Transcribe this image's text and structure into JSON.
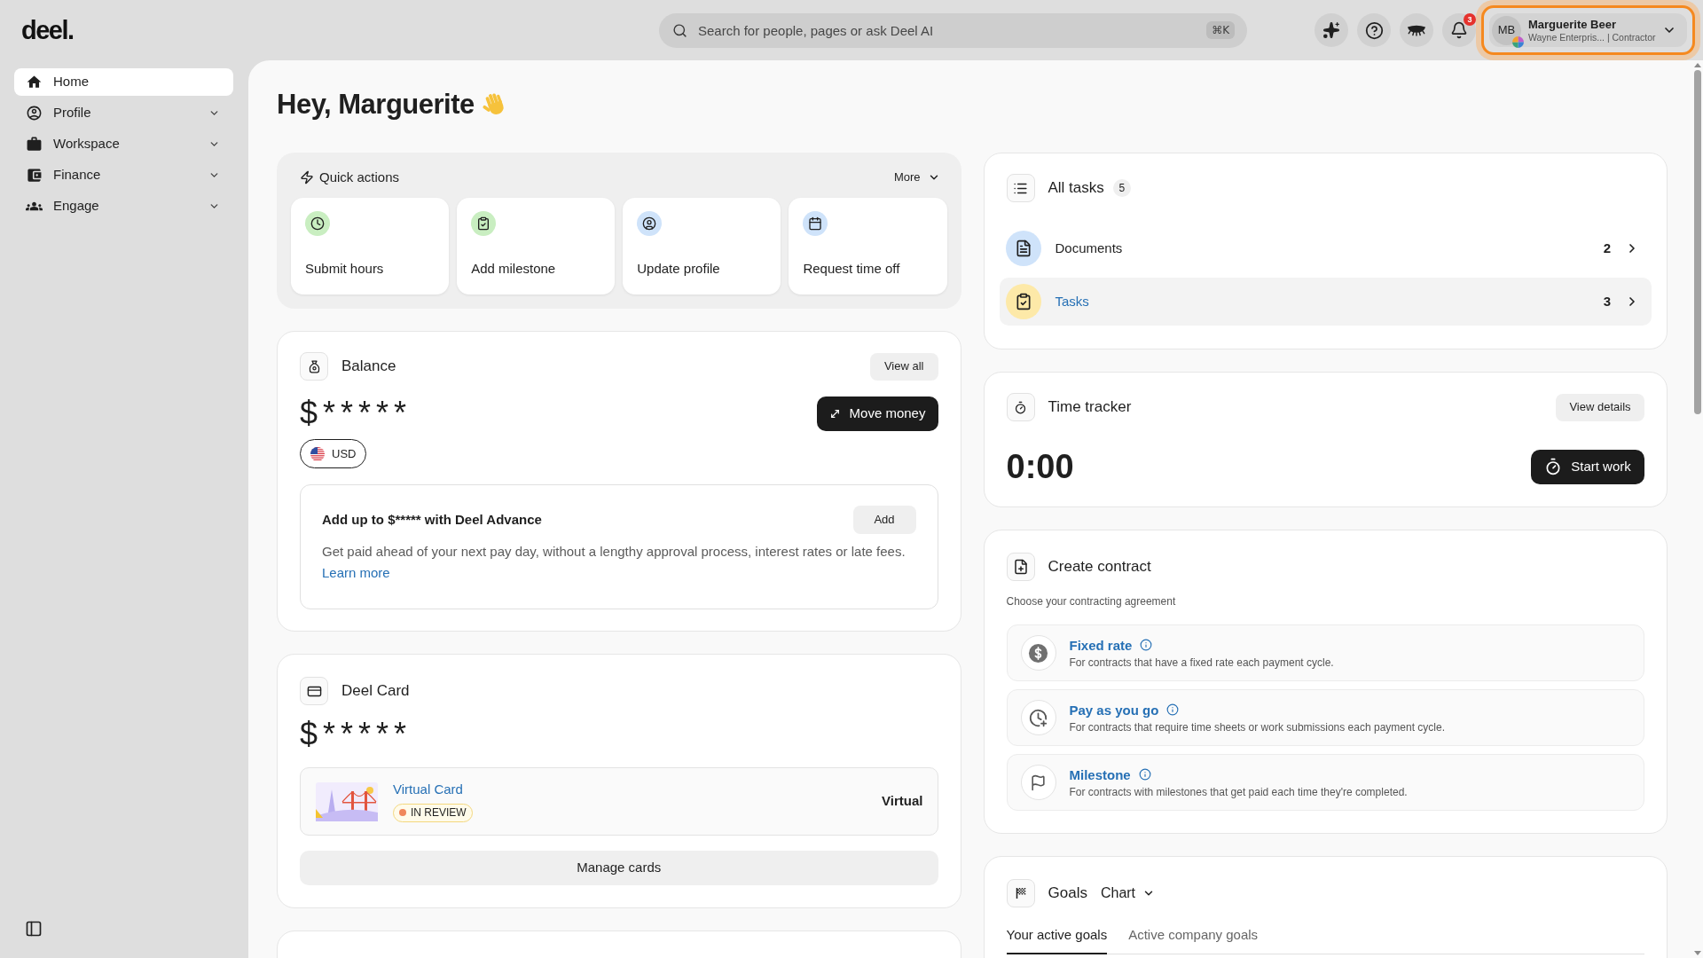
{
  "header": {
    "logo": "deel.",
    "search": {
      "placeholder": "Search for people, pages or ask Deel AI",
      "shortcut": "⌘K"
    },
    "notifications": {
      "count": "3"
    },
    "profile": {
      "initials": "MB",
      "name": "Marguerite Beer",
      "subtitle": "Wayne Enterpris... | Contractor",
      "focused": true
    }
  },
  "sidebar": {
    "items": [
      {
        "label": "Home",
        "kind": "link",
        "selected": true
      },
      {
        "label": "Profile",
        "kind": "group",
        "selected": false,
        "expanded": false
      },
      {
        "label": "Workspace",
        "kind": "group",
        "selected": false,
        "expanded": false
      },
      {
        "label": "Finance",
        "kind": "group",
        "selected": false,
        "expanded": false
      },
      {
        "label": "Engage",
        "kind": "group",
        "selected": false,
        "expanded": false
      }
    ]
  },
  "greeting": "Hey, Marguerite",
  "quick_actions": {
    "title": "Quick actions",
    "more": "More",
    "actions": [
      {
        "label": "Submit hours",
        "color": "#c9eec1"
      },
      {
        "label": "Add milestone",
        "color": "#c9eec1"
      },
      {
        "label": "Update profile",
        "color": "#cfe3fa"
      },
      {
        "label": "Request time off",
        "color": "#cfe3fa"
      }
    ]
  },
  "balance": {
    "title": "Balance",
    "view_all": "View all",
    "amount": "$*****",
    "move_money": "Move money",
    "currency": "USD",
    "advance": {
      "title": "Add up to $***** with Deel Advance",
      "add": "Add",
      "description": "Get paid ahead of your next pay day, without a lengthy approval process, interest rates or late fees.",
      "link": "Learn more"
    }
  },
  "deel_card": {
    "title": "Deel Card",
    "amount": "$*****",
    "card": {
      "name": "Virtual Card",
      "status": "IN REVIEW",
      "type": "Virtual"
    },
    "manage": "Manage cards"
  },
  "all_tasks": {
    "title": "All tasks",
    "count": "5",
    "items": [
      {
        "label": "Documents",
        "count": "2",
        "color": "#cfe3fa",
        "selected": false
      },
      {
        "label": "Tasks",
        "count": "3",
        "color": "#fde9a8",
        "selected": true
      }
    ]
  },
  "time_tracker": {
    "title": "Time tracker",
    "view_details": "View details",
    "time": "0:00",
    "start": "Start work"
  },
  "create_contract": {
    "title": "Create contract",
    "subtitle": "Choose your contracting agreement",
    "options": [
      {
        "title": "Fixed rate",
        "description": "For contracts that have a fixed rate each payment cycle."
      },
      {
        "title": "Pay as you go",
        "description": "For contracts that require time sheets or work submissions each payment cycle."
      },
      {
        "title": "Milestone",
        "description": "For contracts with milestones that get paid each time they're completed."
      }
    ]
  },
  "goals": {
    "title": "Goals",
    "view": "Chart",
    "tabs": [
      {
        "label": "Your active goals",
        "selected": true
      },
      {
        "label": "Active company goals",
        "selected": false
      }
    ]
  }
}
